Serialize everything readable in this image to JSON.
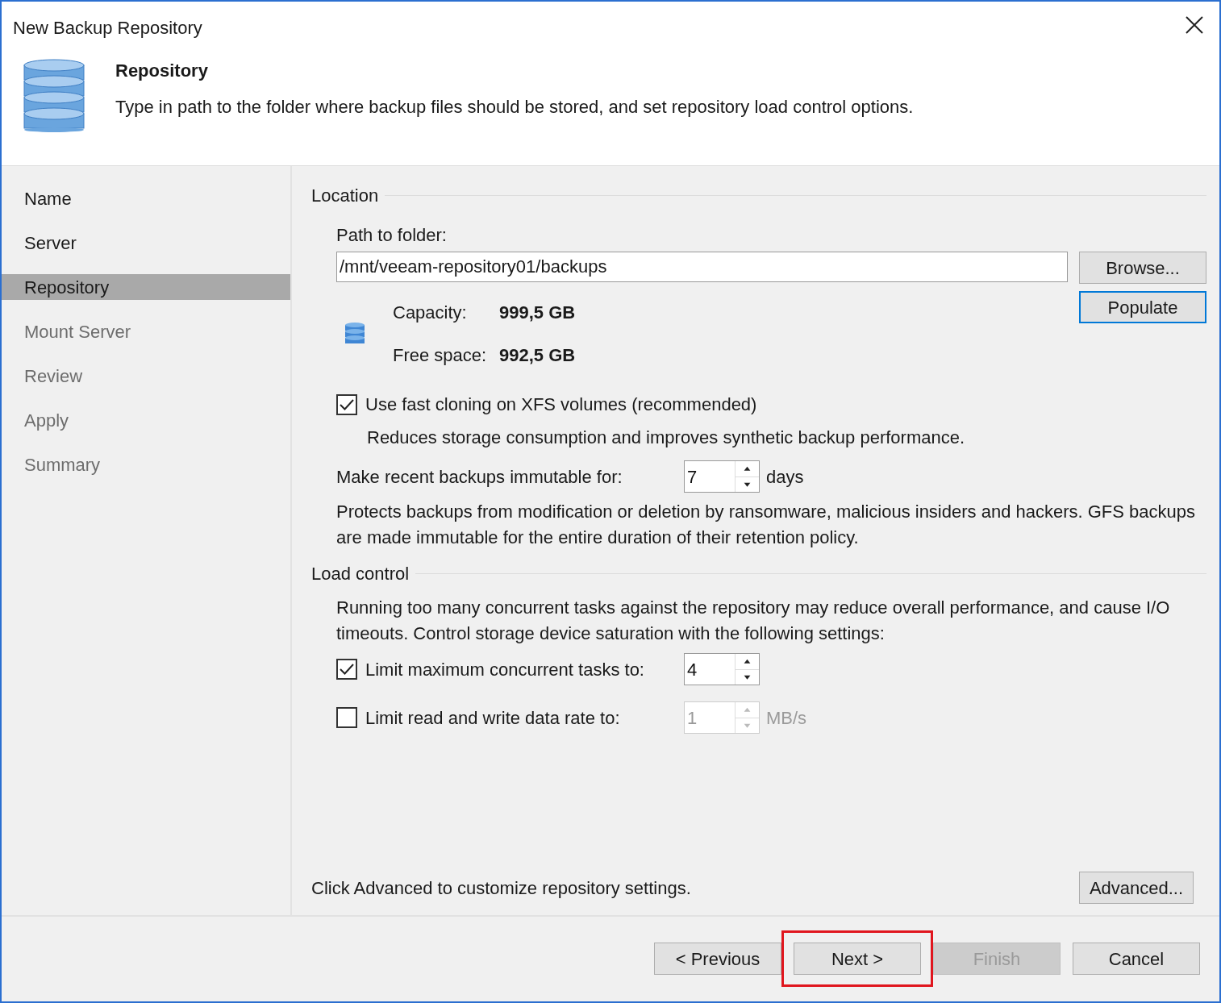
{
  "window": {
    "title": "New Backup Repository"
  },
  "header": {
    "title": "Repository",
    "description": "Type in path to the folder where backup files should be stored, and set repository load control options."
  },
  "steps": [
    {
      "label": "Name",
      "selected": false,
      "disabled": false
    },
    {
      "label": "Server",
      "selected": false,
      "disabled": false
    },
    {
      "label": "Repository",
      "selected": true,
      "disabled": false
    },
    {
      "label": "Mount Server",
      "selected": false,
      "disabled": true
    },
    {
      "label": "Review",
      "selected": false,
      "disabled": true
    },
    {
      "label": "Apply",
      "selected": false,
      "disabled": true
    },
    {
      "label": "Summary",
      "selected": false,
      "disabled": true
    }
  ],
  "location": {
    "heading": "Location",
    "path_label": "Path to folder:",
    "path_value": "/mnt/veeam-repository01/backups",
    "browse": "Browse...",
    "populate": {
      "label": "Populate",
      "focused": true
    },
    "capacity_label": "Capacity:",
    "capacity": "999,5 GB",
    "free_label": "Free space:",
    "free": "992,5 GB"
  },
  "fast_clone": {
    "label": "Use fast cloning on XFS volumes (recommended)",
    "checked": true,
    "note": "Reduces storage consumption and improves synthetic backup performance."
  },
  "immutable": {
    "label": "Make recent backups immutable for:",
    "value": "7",
    "unit": "days",
    "note": "Protects backups from modification or deletion by ransomware, malicious insiders and hackers. GFS backups are made immutable for the entire duration of their retention policy."
  },
  "load_control": {
    "heading": "Load control",
    "note": "Running too many concurrent tasks against the repository may reduce overall performance, and cause I/O timeouts. Control storage device saturation with the following settings:",
    "options": [
      {
        "label": "Limit maximum concurrent tasks to:",
        "checked": true,
        "value": "4"
      },
      {
        "label": "Limit read and write data rate to:",
        "checked": false,
        "value": "1",
        "unit": "MB/s"
      }
    ]
  },
  "advanced": {
    "note": "Click Advanced to customize repository settings.",
    "button": "Advanced..."
  },
  "buttons": [
    {
      "label": "< Previous",
      "disabled": false,
      "highlighted": false
    },
    {
      "label": "Next >",
      "disabled": false,
      "highlighted": true
    },
    {
      "label": "Finish",
      "disabled": true,
      "highlighted": false
    },
    {
      "label": "Cancel",
      "disabled": false,
      "highlighted": false
    }
  ]
}
